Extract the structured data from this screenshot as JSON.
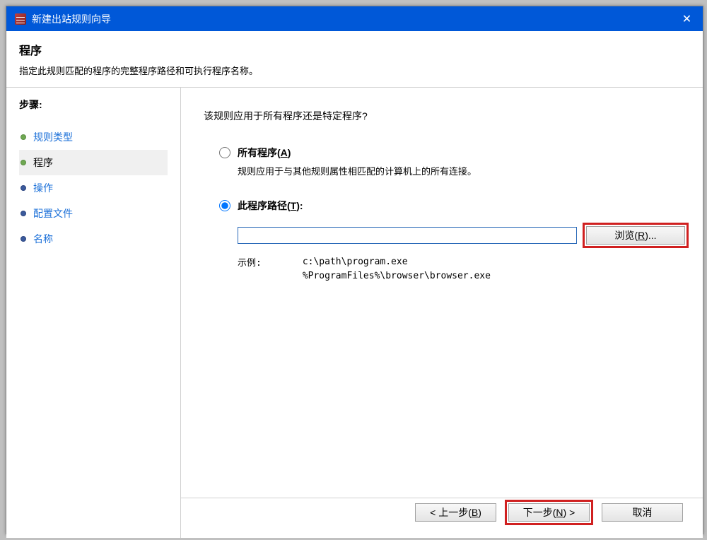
{
  "window": {
    "title": "新建出站规则向导"
  },
  "header": {
    "title": "程序",
    "subtitle": "指定此规则匹配的程序的完整程序路径和可执行程序名称。"
  },
  "sidebar": {
    "steps_label": "步骤:",
    "steps": [
      {
        "label": "规则类型",
        "state": "completed"
      },
      {
        "label": "程序",
        "state": "active"
      },
      {
        "label": "操作",
        "state": "pending"
      },
      {
        "label": "配置文件",
        "state": "pending"
      },
      {
        "label": "名称",
        "state": "pending"
      }
    ]
  },
  "content": {
    "question": "该规则应用于所有程序还是特定程序?",
    "radio_all": {
      "label_pre": "所有程序(",
      "hotkey": "A",
      "label_post": ")",
      "description": "规则应用于与其他规则属性相匹配的计算机上的所有连接。"
    },
    "radio_path": {
      "label_pre": "此程序路径(",
      "hotkey": "T",
      "label_post": "):",
      "input_value": "",
      "browse_label": "浏览(R)...",
      "example_label": "示例:",
      "example_path1": "c:\\path\\program.exe",
      "example_path2": "%ProgramFiles%\\browser\\browser.exe"
    }
  },
  "footer": {
    "back_label": "< 上一步(B)",
    "next_label": "下一步(N) >",
    "cancel_label": "取消"
  }
}
